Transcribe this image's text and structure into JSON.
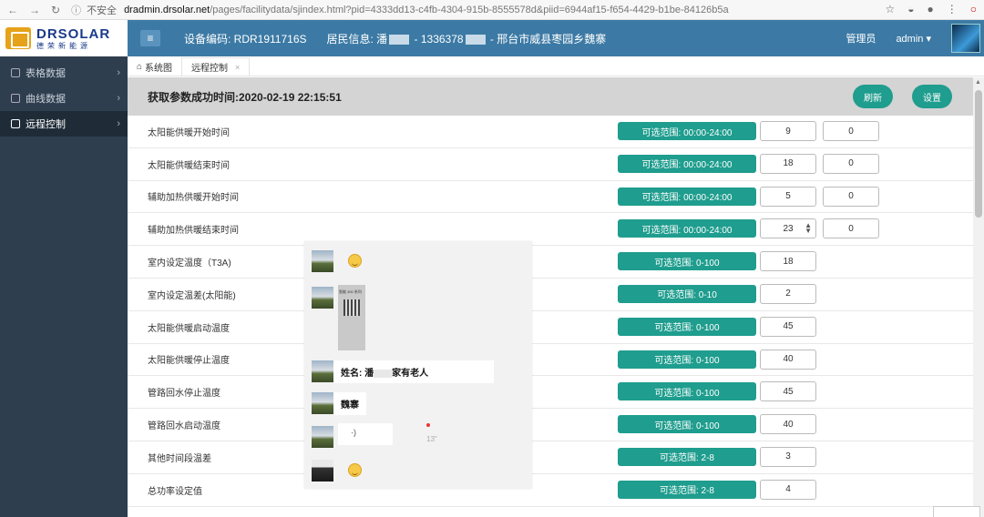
{
  "browser": {
    "security_label": "不安全",
    "url_host": "dradmin.drsolar.net",
    "url_path": "/pages/facilitydata/sjindex.html?pid=4333dd13-c4fb-4304-915b-8555578d&piid=6944af15-f654-4429-b1be-84126b5a"
  },
  "logo": {
    "en": "DRSOLAR",
    "cn": "德荣新能源"
  },
  "header": {
    "device_label": "设备编码: RDR1911716S",
    "resident_prefix": "居民信息: 潘",
    "resident_phone": "- 1336378",
    "resident_location": "- 邢台市威县枣园乡魏寨",
    "role": "管理员",
    "user": "admin"
  },
  "sidebar": {
    "items": [
      {
        "label": "表格数据"
      },
      {
        "label": "曲线数据"
      },
      {
        "label": "远程控制"
      }
    ]
  },
  "tabs": [
    {
      "label": "系统图"
    },
    {
      "label": "远程控制"
    }
  ],
  "toolbar": {
    "status": "获取参数成功时间:2020-02-19 22:15:51",
    "refresh_label": "刷新",
    "settings_label": "设置"
  },
  "params": [
    {
      "name": "太阳能供暖开始时间",
      "range": "可选范围: 00:00-24:00",
      "v1": "9",
      "v2": "0"
    },
    {
      "name": "太阳能供暖结束时间",
      "range": "可选范围: 00:00-24:00",
      "v1": "18",
      "v2": "0"
    },
    {
      "name": "辅助加热供暖开始时间",
      "range": "可选范围: 00:00-24:00",
      "v1": "5",
      "v2": "0"
    },
    {
      "name": "辅助加热供暖结束时间",
      "range": "可选范围: 00:00-24:00",
      "v1": "23",
      "v2": "0"
    },
    {
      "name": "室内设定温度（T3A)",
      "range": "可选范围: 0-100",
      "v1": "18"
    },
    {
      "name": "室内设定温差(太阳能)",
      "range": "可选范围: 0-10",
      "v1": "2"
    },
    {
      "name": "太阳能供暖启动温度",
      "range": "可选范围: 0-100",
      "v1": "45"
    },
    {
      "name": "太阳能供暖停止温度",
      "range": "可选范围: 0-100",
      "v1": "40"
    },
    {
      "name": "管路回水停止温度",
      "range": "可选范围: 0-100",
      "v1": "45"
    },
    {
      "name": "管路回水启动温度",
      "range": "可选范围: 0-100",
      "v1": "40"
    },
    {
      "name": "其他时间段温差",
      "range": "可选范围: 2-8",
      "v1": "3"
    },
    {
      "name": "总功率设定值",
      "range": "可选范围: 2-8",
      "v1": "4"
    }
  ],
  "chat": {
    "photo_caption": "智能 300 系列",
    "name_prefix": "姓名: 潘",
    "name_suffix": "家有老人",
    "village": "魏寨",
    "voice_glyph": "·)",
    "voice_duration": "13\""
  }
}
